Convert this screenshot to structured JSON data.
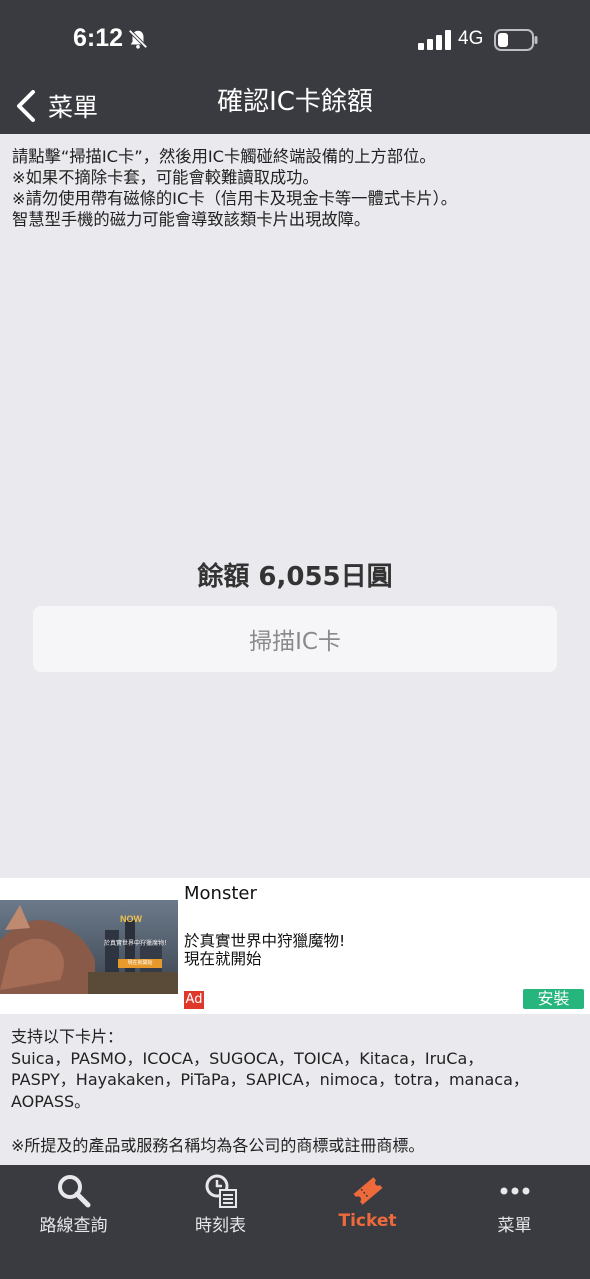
{
  "status": {
    "time": "6:12",
    "network": "4G"
  },
  "nav": {
    "back_label": "菜單",
    "title": "確認IC卡餘額"
  },
  "instructions": {
    "lines": [
      "請點擊“掃描IC卡”，然後用IC卡觸碰終端設備的上方部位。",
      "※如果不摘除卡套，可能會較難讀取成功。",
      "※請勿使用帶有磁條的IC卡（信用卡及現金卡等一體式卡片）。",
      "智慧型手機的磁力可能會導致該類卡片出現故障。"
    ]
  },
  "balance": {
    "text": "餘額 6,055日圓"
  },
  "scan_button": {
    "label": "掃描IC卡"
  },
  "ad": {
    "title": "Monster",
    "desc_line1": "於真實世界中狩獵魔物!",
    "desc_line2": "現在就開始",
    "badge": "Ad",
    "install_label": "安裝",
    "image_logo": "NOW",
    "image_caption": "於真實世界中狩獵魔物！",
    "image_button": "現在就開始"
  },
  "supported": {
    "heading": "支持以下卡片：",
    "line1": "Suica，PASMO，ICOCA，SUGOCA，TOICA，Kitaca，IruCa，",
    "line2": "PASPY，Hayakaken，PiTaPa，SAPICA，nimoca，totra，manaca，",
    "line3": "AOPASS。"
  },
  "trademark": "※所提及的產品或服務名稱均為各公司的商標或註冊商標。",
  "tabs": [
    {
      "label": "路線查詢",
      "icon": "search-icon"
    },
    {
      "label": "時刻表",
      "icon": "timetable-icon"
    },
    {
      "label": "Ticket",
      "icon": "ticket-icon",
      "active": true
    },
    {
      "label": "菜單",
      "icon": "more-icon"
    }
  ],
  "colors": {
    "header": "#3a3b40",
    "background": "#e9e9ee",
    "accent": "#ee6a3a",
    "install": "#27b57e",
    "ad_badge": "#e0372b"
  }
}
